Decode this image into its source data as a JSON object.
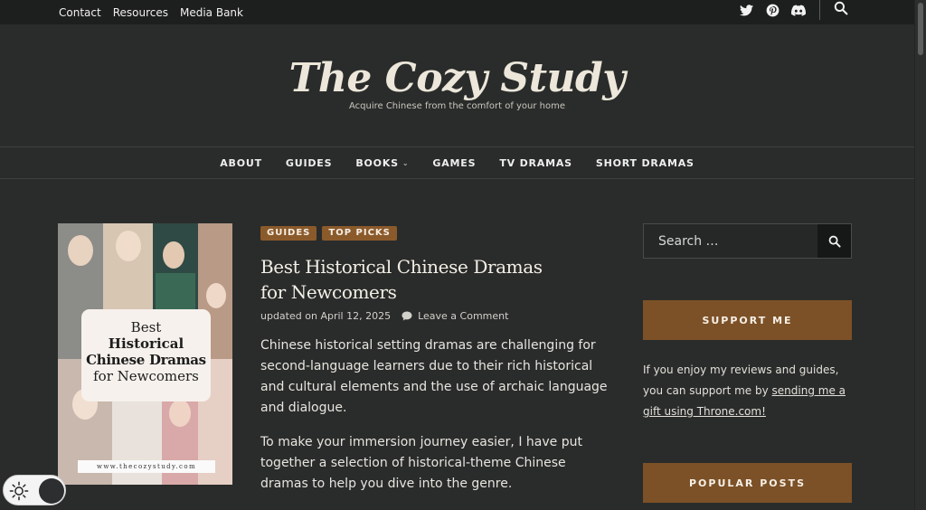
{
  "topbar": {
    "links": [
      "Contact",
      "Resources",
      "Media Bank"
    ],
    "social_icons": [
      "twitter-icon",
      "pinterest-icon",
      "discord-icon"
    ],
    "search_icon": "search-icon"
  },
  "site": {
    "title": "The Cozy Study",
    "tagline": "Acquire Chinese from the comfort of your home"
  },
  "nav": {
    "items": [
      {
        "label": "ABOUT"
      },
      {
        "label": "GUIDES"
      },
      {
        "label": "BOOKS",
        "has_submenu": true
      },
      {
        "label": "GAMES"
      },
      {
        "label": "TV DRAMAS"
      },
      {
        "label": "SHORT DRAMAS"
      }
    ]
  },
  "post": {
    "thumbnail": {
      "line1": "Best",
      "line2": "Historical",
      "line3": "Chinese Dramas",
      "line4": "for Newcomers",
      "url": "www.thecozystudy.com"
    },
    "categories": [
      "GUIDES",
      "TOP PICKS"
    ],
    "title": "Best Historical Chinese Dramas for Newcomers",
    "updated_prefix": "updated on",
    "date": "April 12, 2025",
    "comment_link": "Leave a Comment",
    "excerpt_p1": "Chinese historical setting dramas are challenging for second-language learners due to their rich historical and cultural elements and the use of archaic language and dialogue.",
    "excerpt_p2": "To make your immersion journey easier, I have put together a selection of historical-theme Chinese dramas to help you dive into the genre."
  },
  "sidebar": {
    "search_placeholder": "Search …",
    "support_heading": "SUPPORT ME",
    "support_text_before": "If you enjoy my reviews and guides, you can support me by ",
    "support_link": "sending me a gift using Throne.com!",
    "popular_heading": "POPULAR POSTS"
  },
  "colors": {
    "background": "#2a2c2b",
    "topbar": "#1d1e1e",
    "accent_brown": "#7c5127",
    "category_brown": "#8b5a2b"
  }
}
